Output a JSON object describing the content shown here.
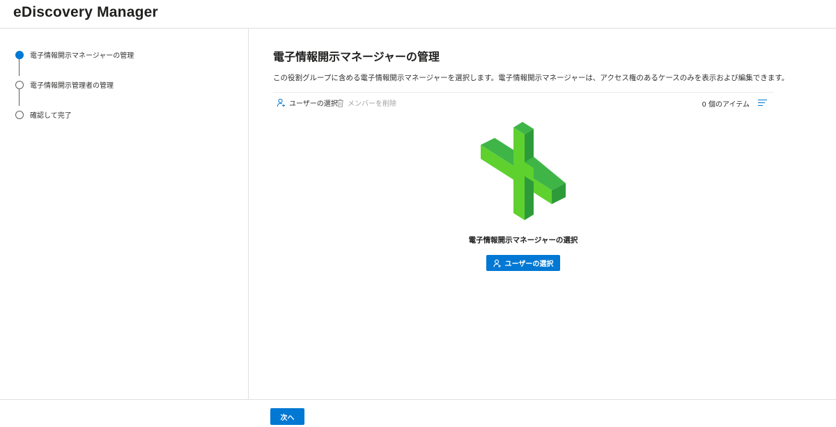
{
  "header": {
    "title": "eDiscovery Manager"
  },
  "steps": [
    {
      "label": "電子情報開示マネージャーの管理",
      "active": true
    },
    {
      "label": "電子情報開示管理者の管理",
      "active": false
    },
    {
      "label": "確認して完了",
      "active": false
    }
  ],
  "main": {
    "title": "電子情報開示マネージャーの管理",
    "description": "この役割グループに含める電子情報開示マネージャーを選択します。電子情報開示マネージャーは、アクセス権のあるケースのみを表示および編集できます。",
    "toolbar": {
      "select_users": "ユーザーの選択",
      "remove_members": "メンバーを削除",
      "item_count": "0 個のアイテム"
    },
    "empty_state": {
      "title": "電子情報開示マネージャーの選択",
      "button": "ユーザーの選択"
    }
  },
  "footer": {
    "next": "次へ"
  },
  "colors": {
    "accent": "#0078d4",
    "illustration_green": "#5fd12f"
  },
  "icons": [
    "person-add-icon",
    "trash-icon",
    "list-menu-icon",
    "person-icon"
  ]
}
